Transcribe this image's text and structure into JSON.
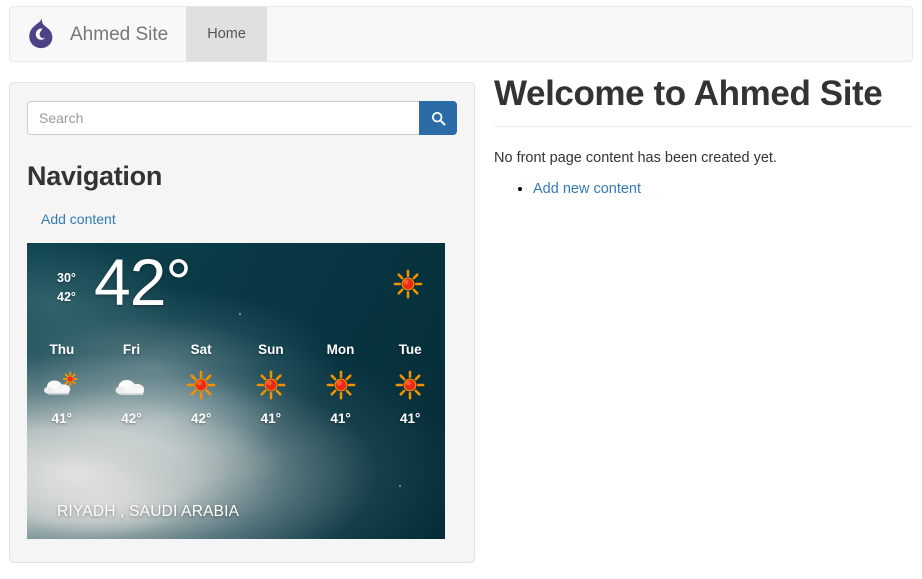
{
  "navbar": {
    "logo_icon": "drupal-drop-icon",
    "logo_color": "#4c4386",
    "site_title": "Ahmed Site",
    "tabs": [
      {
        "label": "Home",
        "active": true
      }
    ]
  },
  "sidebar": {
    "search": {
      "placeholder": "Search",
      "value": "",
      "button_icon": "search-icon",
      "button_color": "#2b6ca7"
    },
    "navigation": {
      "heading": "Navigation",
      "links": [
        {
          "label": "Add content"
        }
      ]
    },
    "weather": {
      "low_temp": "30°",
      "high_temp": "42°",
      "current_temp": "42°",
      "current_icon": "sun-icon",
      "location": "RIYADH , SAUDI ARABIA",
      "forecast": [
        {
          "day": "Thu",
          "icon": "cloud-sun-icon",
          "temp": "41°"
        },
        {
          "day": "Fri",
          "icon": "cloud-icon",
          "temp": "42°"
        },
        {
          "day": "Sat",
          "icon": "sun-icon",
          "temp": "42°"
        },
        {
          "day": "Sun",
          "icon": "sun-icon",
          "temp": "41°"
        },
        {
          "day": "Mon",
          "icon": "sun-icon",
          "temp": "41°"
        },
        {
          "day": "Tue",
          "icon": "sun-icon",
          "temp": "41°"
        }
      ]
    }
  },
  "main": {
    "title": "Welcome to Ahmed Site",
    "body_text": "No front page content has been created yet.",
    "links": [
      {
        "label": "Add new content"
      }
    ]
  }
}
